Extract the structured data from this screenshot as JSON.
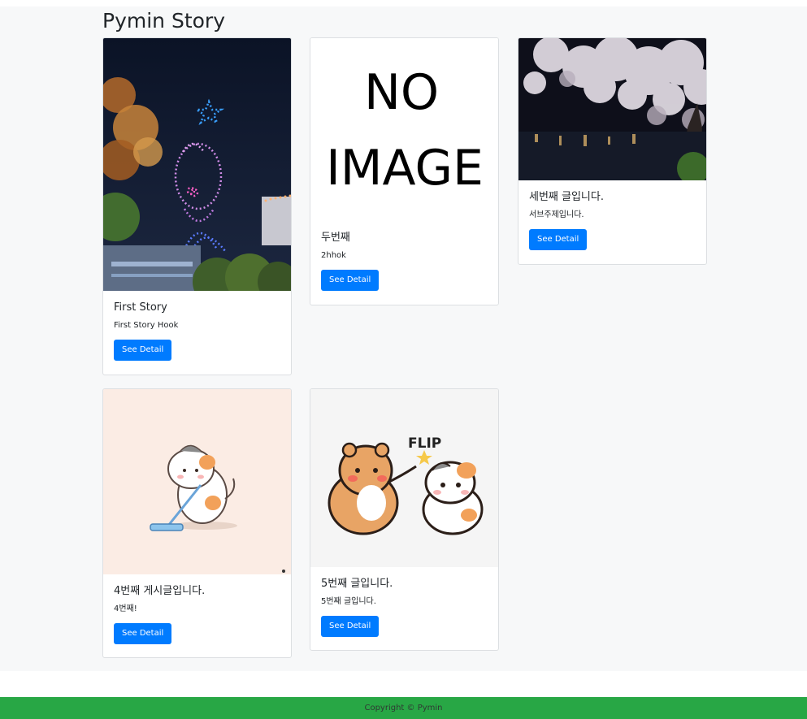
{
  "site": {
    "title": "Pymin Story"
  },
  "cards": [
    {
      "title": "First Story",
      "hook": "First Story Hook",
      "button": "See Detail",
      "image": "drone-light-show-photo"
    },
    {
      "title": "두번째",
      "hook": "2hhok",
      "button": "See Detail",
      "image": "no-image-placeholder",
      "placeholder_line1": "NO",
      "placeholder_line2": "IMAGE"
    },
    {
      "title": "세번째 글입니다.",
      "hook": "서브주제입니다.",
      "button": "See Detail",
      "image": "cherry-blossom-night-photo"
    },
    {
      "title": "4번째 게시글입니다.",
      "hook": "4번째!",
      "button": "See Detail",
      "image": "cat-mopping-illustration"
    },
    {
      "title": "5번째 글입니다.",
      "hook": "5번째 글입니다.",
      "button": "See Detail",
      "image": "bear-and-cat-flip-illustration",
      "image_caption": "FLIP"
    }
  ],
  "footer": {
    "text": "Copyright © Pymin"
  },
  "colors": {
    "primary": "#007bff",
    "footer": "#28a745",
    "background": "#f7f8f9"
  }
}
